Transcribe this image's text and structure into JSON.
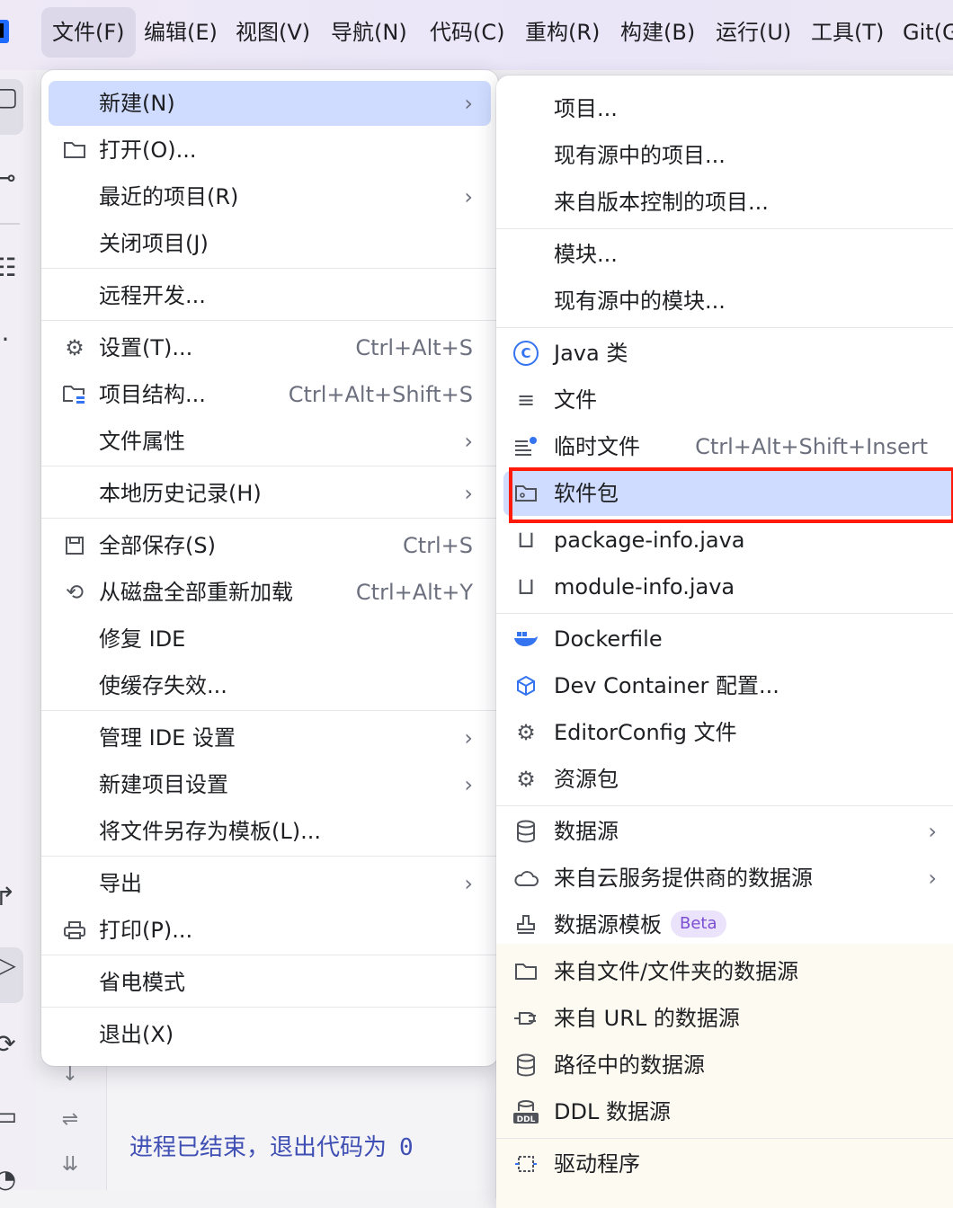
{
  "menubar": {
    "items": [
      "文件(F)",
      "编辑(E)",
      "视图(V)",
      "导航(N)",
      "代码(C)",
      "重构(R)",
      "构建(B)",
      "运行(U)",
      "工具(T)",
      "Git(G"
    ]
  },
  "file_menu": {
    "new": {
      "label": "新建(N)"
    },
    "open": {
      "label": "打开(O)..."
    },
    "recent": {
      "label": "最近的项目(R)"
    },
    "close": {
      "label": "关闭项目(J)"
    },
    "remote": {
      "label": "远程开发..."
    },
    "settings": {
      "label": "设置(T)...",
      "shortcut": "Ctrl+Alt+S"
    },
    "structure": {
      "label": "项目结构...",
      "shortcut": "Ctrl+Alt+Shift+S"
    },
    "props": {
      "label": "文件属性"
    },
    "history": {
      "label": "本地历史记录(H)"
    },
    "saveall": {
      "label": "全部保存(S)",
      "shortcut": "Ctrl+S"
    },
    "reload": {
      "label": "从磁盘全部重新加载",
      "shortcut": "Ctrl+Alt+Y"
    },
    "repair": {
      "label": "修复 IDE"
    },
    "invalidate": {
      "label": "使缓存失效..."
    },
    "manage": {
      "label": "管理 IDE 设置"
    },
    "newproj": {
      "label": "新建项目设置"
    },
    "template": {
      "label": "将文件另存为模板(L)..."
    },
    "export": {
      "label": "导出"
    },
    "print": {
      "label": "打印(P)..."
    },
    "power": {
      "label": "省电模式"
    },
    "exit": {
      "label": "退出(X)"
    }
  },
  "new_menu": {
    "project": {
      "label": "项目..."
    },
    "project_src": {
      "label": "现有源中的项目..."
    },
    "project_vcs": {
      "label": "来自版本控制的项目..."
    },
    "module": {
      "label": "模块..."
    },
    "module_src": {
      "label": "现有源中的模块..."
    },
    "java_class": {
      "label": "Java 类"
    },
    "file": {
      "label": "文件"
    },
    "scratch": {
      "label": "临时文件",
      "shortcut": "Ctrl+Alt+Shift+Insert"
    },
    "package": {
      "label": "软件包"
    },
    "pkg_info": {
      "label": "package-info.java"
    },
    "mod_info": {
      "label": "module-info.java"
    },
    "dockerfile": {
      "label": "Dockerfile"
    },
    "devcontainer": {
      "label": "Dev Container 配置..."
    },
    "editorconfig": {
      "label": "EditorConfig 文件"
    },
    "resource": {
      "label": "资源包"
    },
    "datasource": {
      "label": "数据源"
    },
    "cloud": {
      "label": "来自云服务提供商的数据源"
    },
    "ds_template": {
      "label": "数据源模板",
      "badge": "Beta"
    },
    "from_file": {
      "label": "来自文件/文件夹的数据源"
    },
    "from_url": {
      "label": "来自 URL 的数据源"
    },
    "from_path": {
      "label": "路径中的数据源"
    },
    "ddl": {
      "label": "DDL 数据源"
    },
    "driver": {
      "label": "驱动程序"
    }
  },
  "console": {
    "message": "进程已结束，退出代码为",
    "exit_code": "0"
  },
  "colors": {
    "highlight": "#cfdcff",
    "annotation": "#ff1a0a",
    "accent": "#3574f0"
  }
}
